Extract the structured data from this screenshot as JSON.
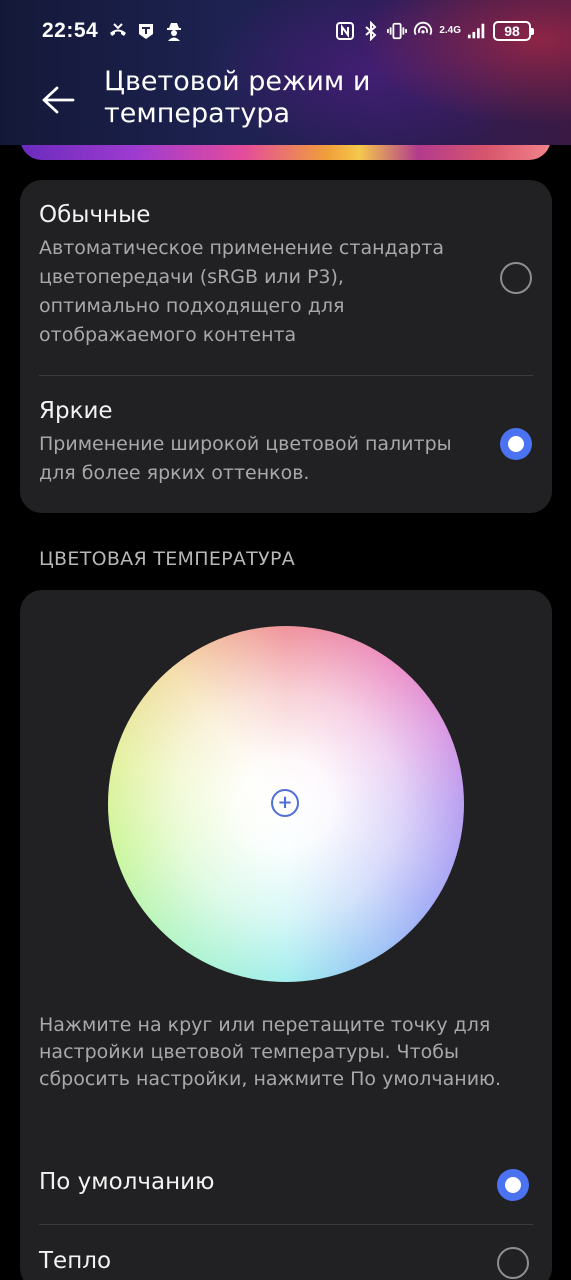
{
  "status_bar": {
    "time": "22:54",
    "battery": "98",
    "network_label": "2.4G"
  },
  "header": {
    "title": "Цветовой режим и температура"
  },
  "color_mode": {
    "options": [
      {
        "title": "Обычные",
        "description": "Автоматическое применение стандарта цветопередачи (sRGB или P3), оптимально подходящего для отображаемого контента",
        "selected": false
      },
      {
        "title": "Яркие",
        "description": "Применение широкой цветовой палитры для более ярких оттенков.",
        "selected": true
      }
    ]
  },
  "color_temperature": {
    "section_title": "ЦВЕТОВАЯ ТЕМПЕРАТУРА",
    "marker_symbol": "+",
    "hint": "Нажмите на круг или перетащите точку для настройки цветовой температуры. Чтобы сбросить настройки, нажмите По умолчанию.",
    "options": [
      {
        "label": "По умолчанию",
        "selected": true
      },
      {
        "label": "Тепло",
        "selected": false
      }
    ]
  },
  "colors": {
    "accent": "#4b72f0",
    "card_bg": "#212123",
    "page_bg": "#000000"
  }
}
